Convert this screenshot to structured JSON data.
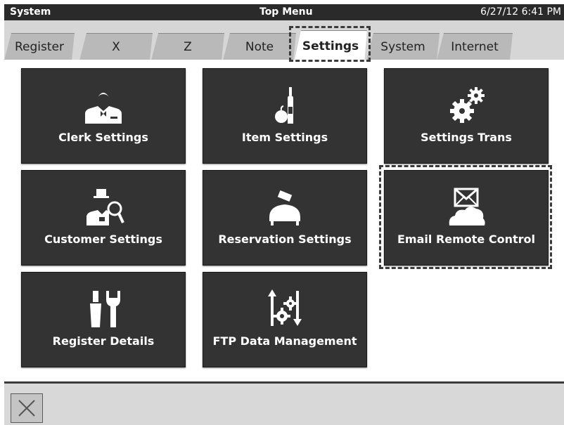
{
  "titlebar": {
    "left": "System",
    "center": "Top Menu",
    "right": "6/27/12 6:41 PM"
  },
  "tabs": [
    {
      "label": "Register"
    },
    {
      "label": "X"
    },
    {
      "label": "Z"
    },
    {
      "label": "Note"
    },
    {
      "label": "Settings",
      "active": true
    },
    {
      "label": "System"
    },
    {
      "label": "Internet"
    }
  ],
  "tiles": [
    {
      "label": "Clerk Settings",
      "icon": "clerk-icon"
    },
    {
      "label": "Item Settings",
      "icon": "item-icon"
    },
    {
      "label": "Settings Trans",
      "icon": "gears-icon"
    },
    {
      "label": "Customer Settings",
      "icon": "customer-icon"
    },
    {
      "label": "Reservation Settings",
      "icon": "reservation-icon"
    },
    {
      "label": "Email Remote Control",
      "icon": "email-icon",
      "highlighted": true
    },
    {
      "label": "Register Details",
      "icon": "tools-icon"
    },
    {
      "label": "FTP Data Management",
      "icon": "ftp-icon"
    }
  ],
  "bottombar": {
    "close_icon": "close-icon"
  }
}
